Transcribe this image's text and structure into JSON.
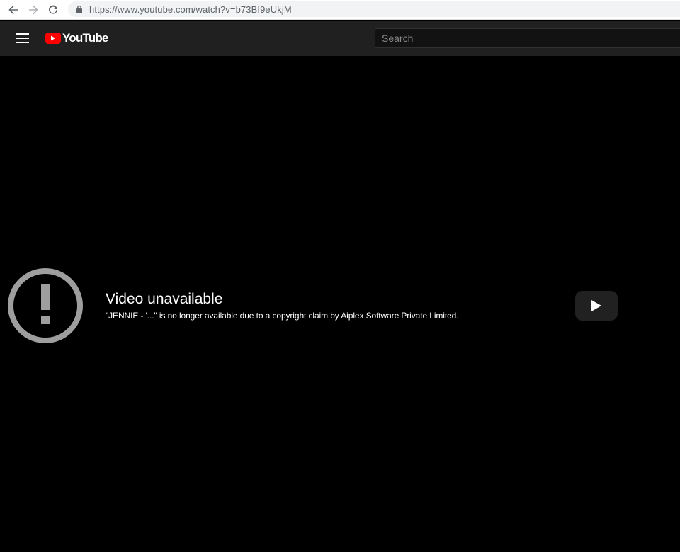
{
  "browser": {
    "url": "https://www.youtube.com/watch?v=b73BI9eUkjM",
    "icons": {
      "back": "arrow-left-icon",
      "forward": "arrow-right-icon",
      "reload": "reload-icon",
      "lock": "lock-icon"
    }
  },
  "header": {
    "logo_text": "YouTube",
    "search_placeholder": "Search",
    "colors": {
      "background": "#202020",
      "logo_red": "#ff0000"
    }
  },
  "player": {
    "error_title": "Video unavailable",
    "error_reason": "\"JENNIE - '...\" is no longer available due to a copyright claim by Aiplex Software Private Limited.",
    "icons": {
      "error": "exclamation-circle-icon",
      "play": "play-icon"
    }
  }
}
